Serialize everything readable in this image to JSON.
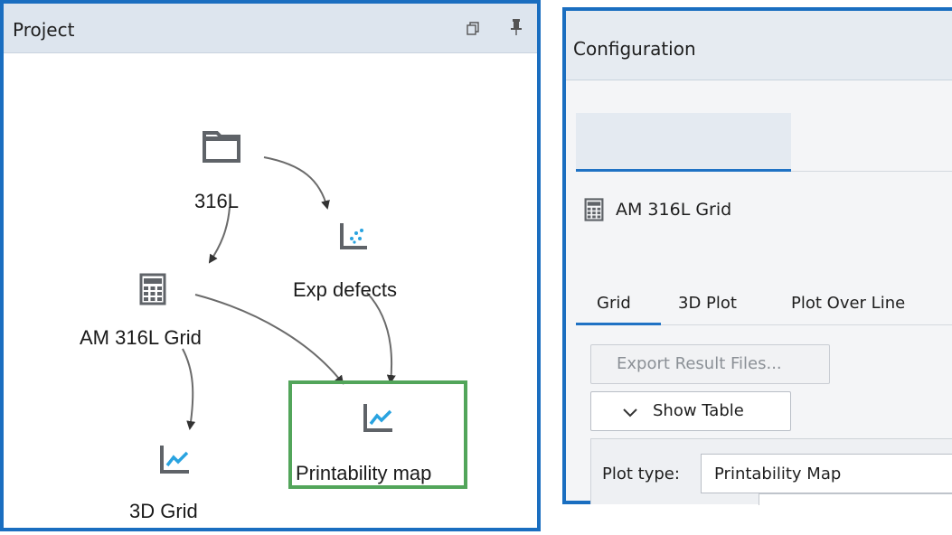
{
  "project": {
    "title": "Project",
    "nodes": {
      "folder": {
        "label": "316L",
        "icon": "folder-icon"
      },
      "exp": {
        "label": "Exp defects",
        "icon": "scatter-chart-icon"
      },
      "grid": {
        "label": "AM 316L Grid",
        "icon": "calculator-icon"
      },
      "printability": {
        "label": "Printability map",
        "icon": "line-chart-icon"
      },
      "grid3d": {
        "label": "3D Grid",
        "icon": "line-chart-icon"
      }
    },
    "selected_node": "printability"
  },
  "configuration": {
    "title": "Configuration",
    "tab": {
      "label": "AM 316L Grid",
      "icon": "calculator-icon"
    },
    "subtabs": [
      "Grid",
      "3D Plot",
      "Plot Over Line"
    ],
    "active_subtab": "Grid",
    "export_button": "Export Result Files...",
    "show_table_button": "Show Table",
    "plot_type_label": "Plot type:",
    "plot_type_value": "Printability Map"
  },
  "colors": {
    "frame_blue": "#1a6ec0",
    "selection_green": "#52a55a",
    "chart_accent": "#29a3e0",
    "icon_gray": "#5f6368"
  }
}
